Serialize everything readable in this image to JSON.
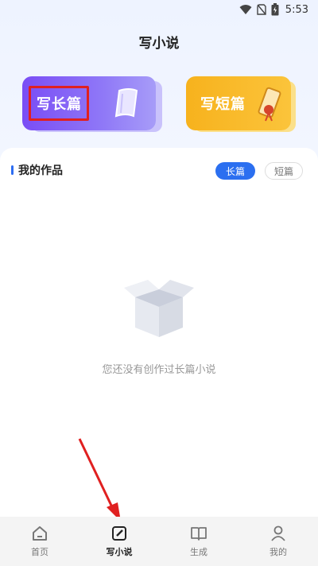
{
  "status_bar": {
    "time": "5:53"
  },
  "header": {
    "title": "写小说"
  },
  "cards": {
    "long": {
      "label": "写长篇"
    },
    "short": {
      "label": "写短篇"
    }
  },
  "section": {
    "title": "我的作品"
  },
  "tabs": [
    {
      "label": "长篇",
      "active": true
    },
    {
      "label": "短篇",
      "active": false
    }
  ],
  "empty_state": {
    "message": "您还没有创作过长篇小说"
  },
  "bottom_nav": [
    {
      "label": "首页",
      "icon": "home-icon",
      "active": false
    },
    {
      "label": "写小说",
      "icon": "edit-icon",
      "active": true
    },
    {
      "label": "生成",
      "icon": "book-open-icon",
      "active": false
    },
    {
      "label": "我的",
      "icon": "user-icon",
      "active": false
    }
  ],
  "colors": {
    "accent": "#2b6ff0",
    "long_card": "#7a4df5",
    "short_card": "#f7b21d",
    "annotation": "#e02020"
  }
}
